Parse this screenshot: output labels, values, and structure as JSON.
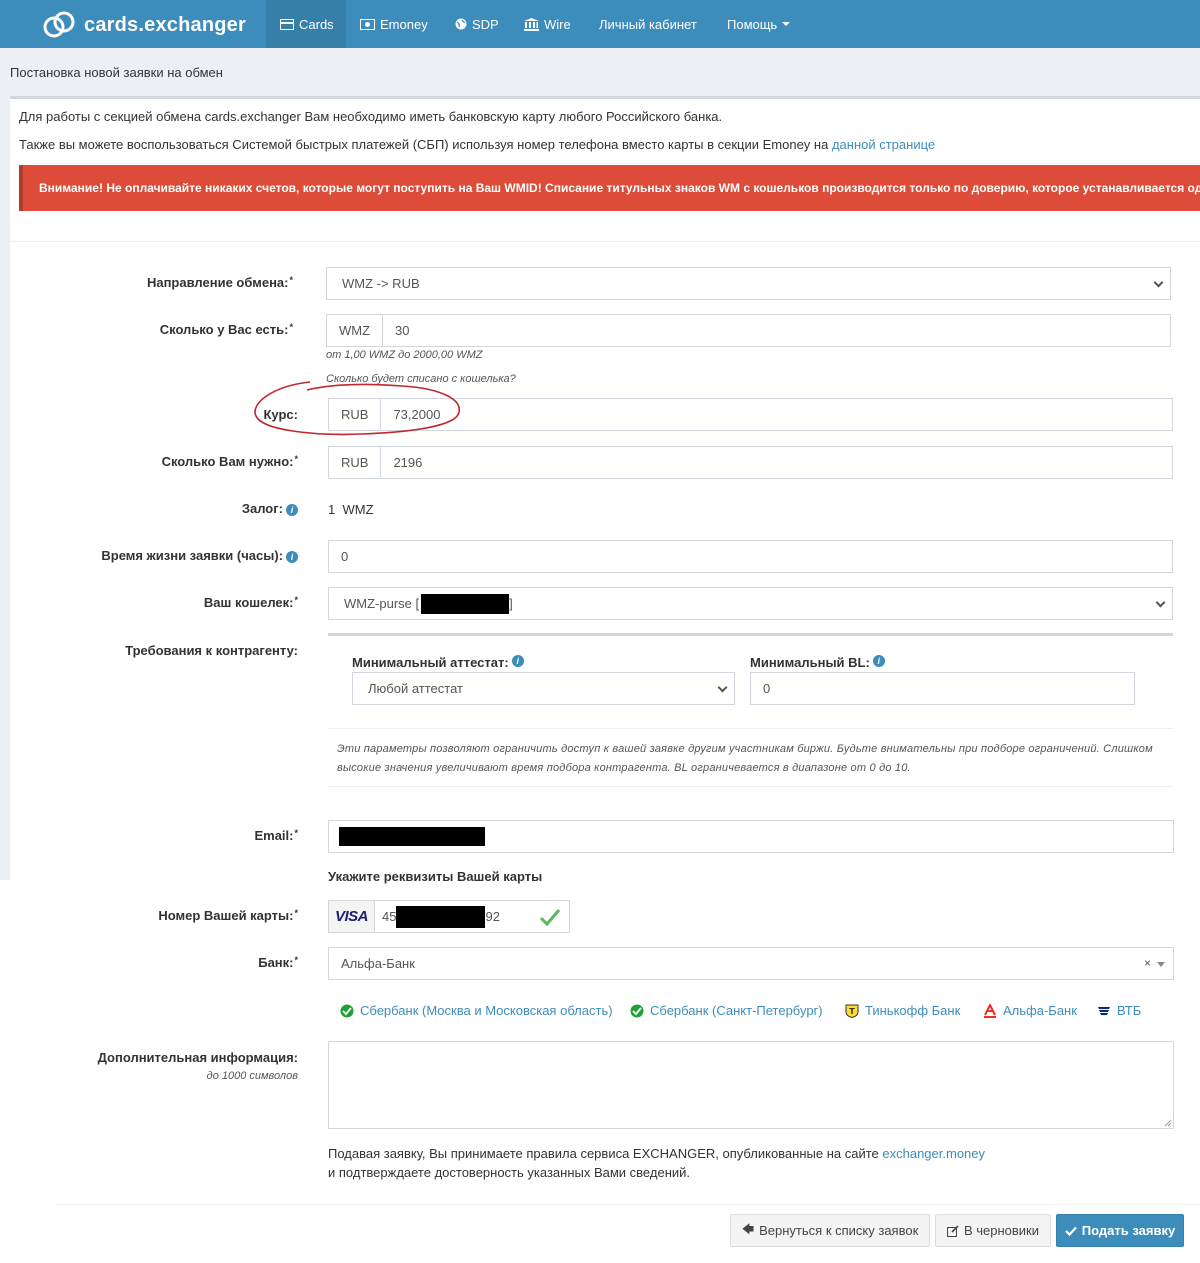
{
  "nav": {
    "brand": "cards.exchanger",
    "items": [
      {
        "label": "Cards",
        "icon": "card-icon"
      },
      {
        "label": "Emoney",
        "icon": "money-icon"
      },
      {
        "label": "SDP",
        "icon": "globe-icon"
      },
      {
        "label": "Wire",
        "icon": "bank-building-icon"
      },
      {
        "label": "Личный кабинет"
      },
      {
        "label": "Помощь"
      }
    ]
  },
  "page": {
    "title": "Постановка новой заявки на обмен",
    "info1": "Для работы с секцией обмена cards.exchanger Вам необходимо иметь банковскую карту любого Российского банка.",
    "info2_text": "Также вы можете воспользоваться Системой быстрых платежей (СБП) используя номер телефона вместо карты в секции Emoney на",
    "info2_link": "данной странице",
    "alert": "Внимание! Не оплачивайте никаких счетов, которые могут поступить на Ваш WMID! Списание титульных знаков WM с кошельков производится только по доверию, которое устанавливается один"
  },
  "form": {
    "direction": {
      "label": "Направление обмена:",
      "value": "WMZ -> RUB"
    },
    "have": {
      "label": "Сколько у Вас есть:",
      "currency": "WMZ",
      "value": "30",
      "hint": "от 1,00 WMZ до 2000,00 WMZ",
      "link": "Сколько будет списано с кошелька?"
    },
    "rate": {
      "label": "Курс:",
      "currency": "RUB",
      "value": "73,2000"
    },
    "need": {
      "label": "Сколько Вам нужно:",
      "currency": "RUB",
      "value": "2196"
    },
    "deposit": {
      "label": "Залог:",
      "amount": "1",
      "currency": "WMZ"
    },
    "lifetime": {
      "label": "Время жизни заявки (часы):",
      "value": "0"
    },
    "wallet": {
      "label": "Ваш кошелек:",
      "prefix": "WMZ-purse [",
      "suffix": "]"
    },
    "requirements": {
      "label": "Требования к контрагенту:",
      "attestat_label": "Минимальный аттестат:",
      "attestat_value": "Любой аттестат",
      "bl_label": "Минимальный BL:",
      "bl_value": "0",
      "note": "Эти параметры позволяют ограничить доступ к вашей заявке другим участникам биржи. Будьте внимательны при подборе ограничений. Слишком высокие значения увеличивают время подбора контрагента. BL ограничевается в диапазоне от 0 до 10."
    },
    "email": {
      "label": "Email:"
    },
    "card_section": "Укажите реквизиты Вашей карты",
    "card": {
      "label": "Номер Вашей карты:",
      "brand": "VISA",
      "prefix": "45",
      "suffix": "92"
    },
    "bank": {
      "label": "Банк:",
      "value": "Альфа-Банк",
      "clear": "×"
    },
    "bank_links": [
      {
        "label": "Сбербанк (Москва и Московская область)",
        "icon": "sberbank-icon"
      },
      {
        "label": "Сбербанк (Санкт-Петербург)",
        "icon": "sberbank-icon"
      },
      {
        "label": "Тинькофф Банк",
        "icon": "tinkoff-icon"
      },
      {
        "label": "Альфа-Банк",
        "icon": "alfa-icon"
      },
      {
        "label": "ВТБ",
        "icon": "vtb-icon"
      }
    ],
    "extra": {
      "label": "Дополнительная информация:",
      "hint": "до 1000 символов"
    },
    "terms_text": "Подавая заявку, Вы принимаете правила сервиса EXCHANGER, опубликованные на сайте",
    "terms_link": "exchanger.money",
    "terms_text2": "и подтверждаете достоверность указанных Вами сведений."
  },
  "buttons": {
    "back": "Вернуться к списку заявок",
    "draft": "В черновики",
    "submit": "Подать заявку"
  },
  "colors": {
    "navbar": "#3c8dbc",
    "alert": "#dd4b39",
    "link": "#3c8dbc",
    "annotation": "#c0282d"
  }
}
